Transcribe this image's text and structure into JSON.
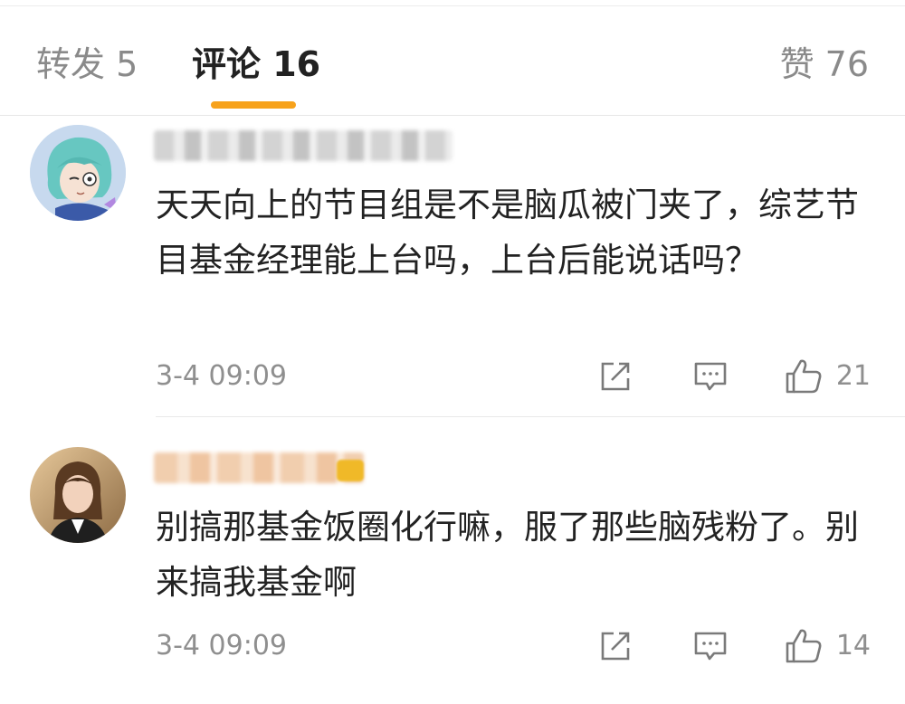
{
  "tabs": {
    "repost": "转发 5",
    "comment": "评论 16",
    "like": "赞 76"
  },
  "comments": [
    {
      "username": "",
      "text": "天天向上的节目组是不是脑瓜被门夹了，综艺节目基金经理能上台吗，上台后能说话吗？",
      "timestamp": "3-4 09:09",
      "likes": "21",
      "avatar_icon": "anime-character-avatar"
    },
    {
      "username": "",
      "text": "别搞那基金饭圈化行嘛，服了那些脑残粉了。别来搞我基金啊",
      "timestamp": "3-4 09:09",
      "likes": "14",
      "avatar_icon": "photo-woman-avatar"
    }
  ],
  "colors": {
    "accent_underline": "#f7a21b",
    "muted_text": "#8f8f8f",
    "main_text": "#222222"
  }
}
